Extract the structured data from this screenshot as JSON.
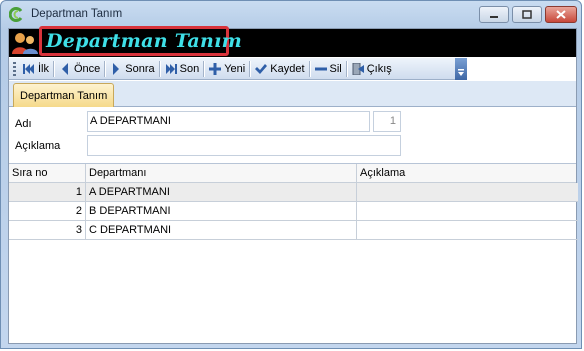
{
  "window": {
    "title": "Departman Tanım",
    "header_title": "Departman Tanım"
  },
  "toolbar": {
    "items": [
      {
        "label": "İlk",
        "icon": "first-icon"
      },
      {
        "label": "Önce",
        "icon": "previous-icon"
      },
      {
        "label": "Sonra",
        "icon": "next-icon"
      },
      {
        "label": "Son",
        "icon": "last-icon"
      },
      {
        "label": "Yeni",
        "icon": "plus-icon"
      },
      {
        "label": "Kaydet",
        "icon": "checkmark-icon"
      },
      {
        "label": "Sil",
        "icon": "minus-icon"
      },
      {
        "label": "Çıkış",
        "icon": "exit-door-icon"
      }
    ]
  },
  "tab": {
    "label": "Departman Tanım"
  },
  "form": {
    "name_label": "Adı",
    "name_value": "A DEPARTMANI",
    "number_value": "1",
    "description_label": "Açıklama",
    "description_value": ""
  },
  "grid": {
    "columns": [
      "Sıra no",
      "Departmanı",
      "Açıklama"
    ],
    "rows": [
      {
        "no": "1",
        "department": "A DEPARTMANI",
        "description": ""
      },
      {
        "no": "2",
        "department": "B DEPARTMANI",
        "description": ""
      },
      {
        "no": "3",
        "department": "C DEPARTMANI",
        "description": ""
      }
    ],
    "selected_row": 1
  },
  "colors": {
    "header_title": "#3fe0e8",
    "header_border": "#d9333b",
    "tab_bg": "#f5d98a"
  }
}
